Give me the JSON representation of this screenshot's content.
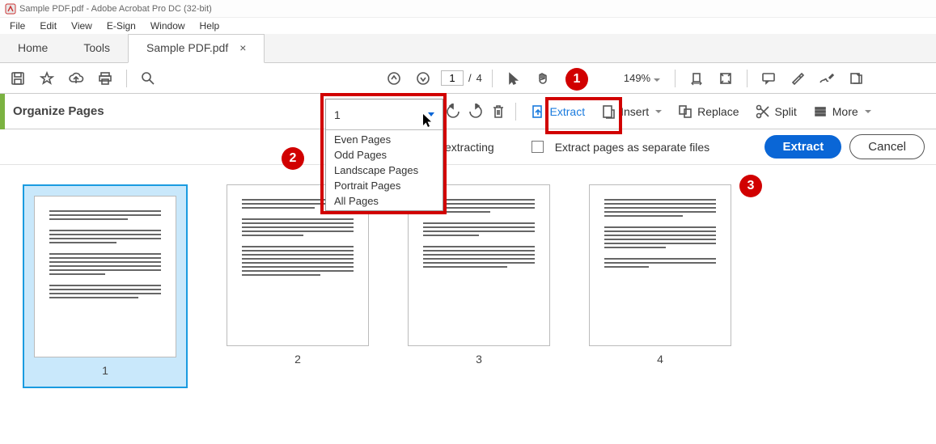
{
  "window": {
    "title": "Sample PDF.pdf - Adobe Acrobat Pro DC (32-bit)"
  },
  "menu": {
    "items": [
      "File",
      "Edit",
      "View",
      "E-Sign",
      "Window",
      "Help"
    ]
  },
  "tabs": {
    "home": "Home",
    "tools": "Tools",
    "doc": "Sample PDF.pdf"
  },
  "page": {
    "current": "1",
    "sep": "/",
    "total": "4"
  },
  "zoom": {
    "level": "149%"
  },
  "subbar": {
    "title": "Organize Pages",
    "extract": "Extract",
    "insert": "Insert",
    "replace": "Replace",
    "split": "Split",
    "more": "More"
  },
  "dropdown": {
    "value": "1",
    "options": [
      "Even Pages",
      "Odd Pages",
      "Landscape Pages",
      "Portrait Pages",
      "All Pages"
    ]
  },
  "extractbar": {
    "opt1_fragment": "extracting",
    "opt2": "Extract pages as separate files",
    "btn_extract": "Extract",
    "btn_cancel": "Cancel"
  },
  "thumbs": [
    "1",
    "2",
    "3",
    "4"
  ],
  "badges": {
    "b1": "1",
    "b2": "2",
    "b3": "3"
  }
}
